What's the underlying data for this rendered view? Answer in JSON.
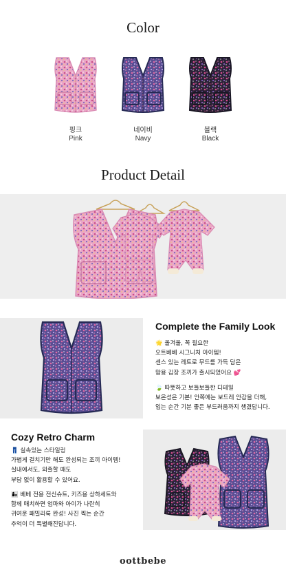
{
  "color_section": {
    "heading": "Color",
    "swatches": [
      {
        "korean": "핑크",
        "english": "Pink",
        "fill": "#e9a3c4",
        "trim": "#e9a3c4"
      },
      {
        "korean": "네이비",
        "english": "Navy",
        "fill": "#6a5ba0",
        "trim": "#2a2f5c"
      },
      {
        "korean": "블랙",
        "english": "Black",
        "fill": "#3b2c4e",
        "trim": "#1e1b2b"
      }
    ]
  },
  "detail_section": {
    "heading": "Product Detail"
  },
  "family_look": {
    "title": "Complete the Family Look",
    "para1": [
      "🌟 올겨울, 꼭 필요한",
      "오트베베 시그니처 아이템!",
      "센스 있는 레트로 무드를 가득 담은",
      "맘용 김장 조끼가 출시되었어요 💕"
    ],
    "para2": [
      "🍃 따뜻하고 보들보들한 디테일",
      "보온성은 기본! 안쪽에는 보드레 안감을 더해,",
      "입는 순간 기분 좋은 부드러움까지 챙겼답니다."
    ]
  },
  "retro_charm": {
    "title": "Cozy Retro Charm",
    "para1": [
      "👖 실속있는 스타일링",
      "가볍게 걸치기만 해도 완성되는 조끼 아이템!",
      "실내에서도, 외출할 때도",
      "부담 없이 활용할 수 있어요."
    ],
    "para2": [
      "👩‍👧 베베 전용 전신슈트, 키즈용 상하세트와",
      "함께 매치하면 엄마와 아이가 나란히",
      "귀여운 패밀리룩 완성! 사진 찍는 순간",
      "추억이 더 특별해진답니다."
    ]
  },
  "brand": "oottbebe"
}
